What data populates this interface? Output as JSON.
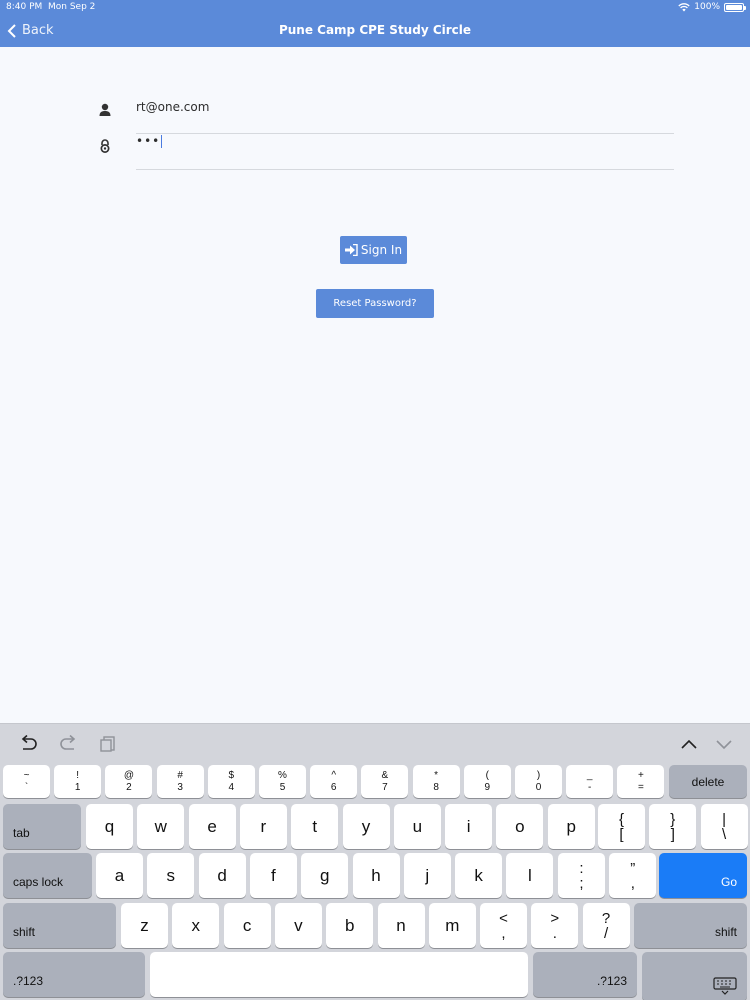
{
  "status_bar": {
    "time": "8:40 PM",
    "date": "Mon Sep 2",
    "battery": "100%",
    "battery_level": 1.0
  },
  "nav": {
    "back_label": "Back",
    "title": "Pune Camp CPE Study Circle"
  },
  "form": {
    "username": {
      "value": "rt@one.com",
      "icon": "user-icon"
    },
    "password": {
      "value": "•••",
      "icon": "lock-icon"
    },
    "signin_label": "Sign In",
    "reset_label": "Reset Password?"
  },
  "keyboard": {
    "toolbar": [
      "undo-icon",
      "redo-icon",
      "paste-icon",
      "chevron-up-icon",
      "chevron-down-icon"
    ],
    "number_row": [
      {
        "top": "~",
        "bottom": "`"
      },
      {
        "top": "!",
        "bottom": "1"
      },
      {
        "top": "@",
        "bottom": "2"
      },
      {
        "top": "#",
        "bottom": "3"
      },
      {
        "top": "$",
        "bottom": "4"
      },
      {
        "top": "%",
        "bottom": "5"
      },
      {
        "top": "^",
        "bottom": "6"
      },
      {
        "top": "&",
        "bottom": "7"
      },
      {
        "top": "*",
        "bottom": "8"
      },
      {
        "top": "(",
        "bottom": "9"
      },
      {
        "top": ")",
        "bottom": "0"
      },
      {
        "top": "_",
        "bottom": "-"
      },
      {
        "top": "+",
        "bottom": "="
      }
    ],
    "delete": "delete",
    "tab": "tab",
    "row_q": [
      "q",
      "w",
      "e",
      "r",
      "t",
      "y",
      "u",
      "i",
      "o",
      "p"
    ],
    "row_q_sym": [
      {
        "top": "{",
        "bottom": "["
      },
      {
        "top": "}",
        "bottom": "]"
      },
      {
        "top": "|",
        "bottom": "\\"
      }
    ],
    "caps": "caps lock",
    "row_a": [
      "a",
      "s",
      "d",
      "f",
      "g",
      "h",
      "j",
      "k",
      "l"
    ],
    "row_a_sym": [
      {
        "top": ":",
        "bottom": ";"
      },
      {
        "top": "”",
        "bottom": ","
      }
    ],
    "go": "Go",
    "shift": "shift",
    "row_z": [
      "z",
      "x",
      "c",
      "v",
      "b",
      "n",
      "m"
    ],
    "row_z_sym": [
      {
        "top": "<",
        "bottom": ","
      },
      {
        "top": ">",
        "bottom": "."
      },
      {
        "top": "?",
        "bottom": "/"
      }
    ],
    "numbers_key": ".?123"
  }
}
